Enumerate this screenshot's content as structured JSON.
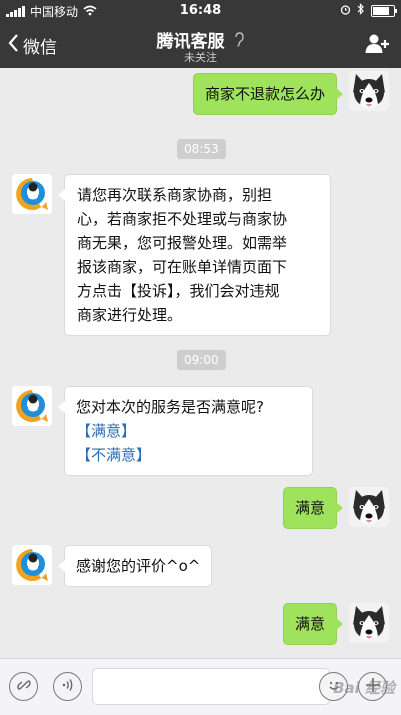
{
  "status_bar": {
    "carrier": "中国移动",
    "time": "16:48",
    "battery_level": 0.9
  },
  "nav": {
    "back_label": "微信",
    "title": "腾讯客服",
    "subtitle": "未关注"
  },
  "messages": [
    {
      "from": "user",
      "text": "商家不退款怎么办"
    },
    {
      "type": "time",
      "text": "08:53"
    },
    {
      "from": "bot",
      "lines": [
        "请您再次联系商家协商，别担",
        "心，若商家拒不处理或与商家协",
        "商无果，您可报警处理。如需举",
        "报该商家，可在账单详情页面下",
        "方点击【投诉】，我们会对违规",
        "商家进行处理。"
      ]
    },
    {
      "type": "time",
      "text": "09:00"
    },
    {
      "from": "bot",
      "text": "您对本次的服务是否满意呢?",
      "links": [
        "【满意】",
        "【不满意】"
      ]
    },
    {
      "from": "user",
      "text": "满意"
    },
    {
      "from": "bot",
      "text": "感谢您的评价^o^"
    },
    {
      "from": "user",
      "text": "满意"
    }
  ],
  "watermark": "Bai 经验",
  "colors": {
    "nav_bg": "#383838",
    "chat_bg": "#ebebeb",
    "user_bubble": "#9fe25c",
    "bot_bubble": "#ffffff",
    "link": "#2b6cb6"
  },
  "icons": {
    "signal": "signal-icon",
    "wifi": "wifi-icon",
    "alarm": "alarm-icon",
    "bluetooth": "bluetooth-icon",
    "battery": "battery-icon",
    "back": "chevron-left-icon",
    "voice_note": "ear-icon",
    "add_contact": "add-user-icon",
    "voice_mode": "voice-icon",
    "emoji": "emoji-icon",
    "more": "plus-icon"
  }
}
